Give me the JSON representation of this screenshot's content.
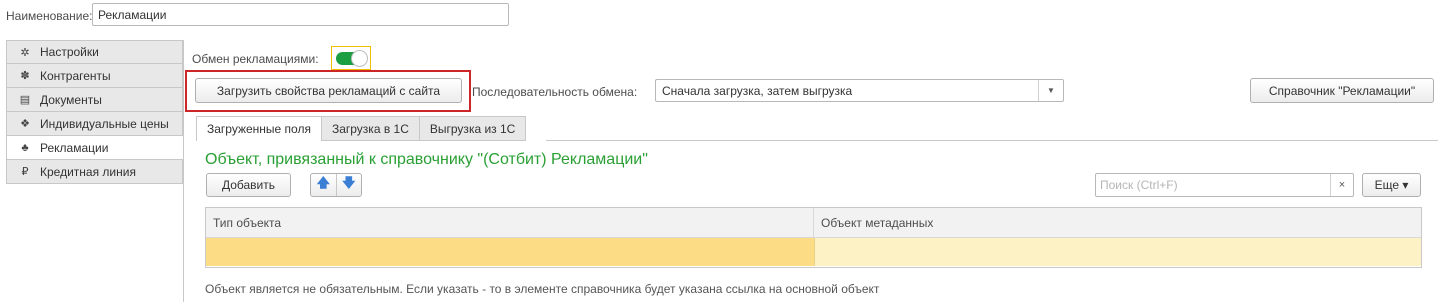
{
  "header": {
    "name_label": "Наименование:",
    "name_value": "Рекламации"
  },
  "sidebar": {
    "items": [
      {
        "label": "Настройки",
        "icon": "gear-icon",
        "glyph": "✲",
        "active": false
      },
      {
        "label": "Контрагенты",
        "icon": "people-icon",
        "glyph": "✽",
        "active": false
      },
      {
        "label": "Документы",
        "icon": "document-icon",
        "glyph": "▤",
        "active": false
      },
      {
        "label": "Индивидуальные цены",
        "icon": "price-tag-icon",
        "glyph": "❖",
        "active": false
      },
      {
        "label": "Рекламации",
        "icon": "complaint-icon",
        "glyph": "♣",
        "active": true
      },
      {
        "label": "Кредитная линия",
        "icon": "ruble-icon",
        "glyph": "₽",
        "active": false
      }
    ]
  },
  "exchange": {
    "label": "Обмен рекламациями:",
    "enabled": true,
    "accent": "#1c9f43"
  },
  "toolbar": {
    "load_button": "Загрузить свойства рекламаций с сайта",
    "sequence_label": "Последовательность обмена:",
    "sequence_value": "Сначала загрузка, затем выгрузка",
    "reference_button": "Справочник \"Рекламации\""
  },
  "tabs": [
    {
      "label": "Загруженные поля",
      "active": true
    },
    {
      "label": "Загрузка в 1С",
      "active": false
    },
    {
      "label": "Выгрузка из 1С",
      "active": false
    }
  ],
  "group": {
    "title": "Объект, привязанный к справочнику \"(Сотбит) Рекламации\"",
    "title_color": "#2aa034",
    "add_button": "Добавить",
    "search_placeholder": "Поиск (Ctrl+F)",
    "search_clear": "×",
    "more_button": "Еще ▾",
    "columns": [
      "Тип объекта",
      "Объект метаданных"
    ],
    "rows": [
      [
        "",
        ""
      ]
    ],
    "note": "Объект является не обязательным. Если указать - то в элементе справочника будет указана ссылка на основной объект"
  }
}
